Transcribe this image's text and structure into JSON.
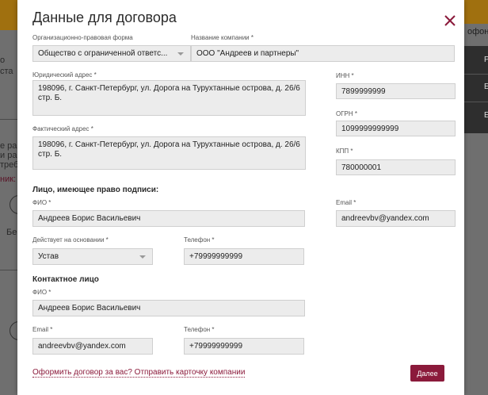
{
  "background": {
    "left_texts": [
      "о",
      "ста",
      "е ра",
      "и ра",
      "треб",
      "ник:",
      "Бе"
    ],
    "right_texts": [
      "офон",
      "Р",
      "Е",
      "Е"
    ]
  },
  "modal": {
    "title": "Данные для договора",
    "close_icon": "close-icon",
    "org_form": {
      "label": "Организационно-правовая форма",
      "value": "Общество с ограниченной ответс..."
    },
    "company_name": {
      "label": "Название компании *",
      "value": "ООО \"Андреев и партнеры\""
    },
    "legal_address": {
      "label": "Юридический адрес *",
      "value": "198096, г. Санкт-Петербург, ул. Дорога на Турухтанные острова, д. 26/6 стр. Б."
    },
    "actual_address": {
      "label": "Фактический адрес *",
      "value": "198096, г. Санкт-Петербург, ул. Дорога на Турухтанные острова, д. 26/6 стр. Б."
    },
    "inn": {
      "label": "ИНН *",
      "value": "7899999999"
    },
    "ogrn": {
      "label": "ОГРН *",
      "value": "1099999999999"
    },
    "kpp": {
      "label": "КПП *",
      "value": "780000001"
    },
    "signatory": {
      "section_title": "Лицо, имеющее право подписи:",
      "fio_label": "ФИО *",
      "fio_value": "Андреев Борис Васильевич",
      "email_label": "Email *",
      "email_value": "andreevbv@yandex.com",
      "basis_label": "Действует на основании *",
      "basis_value": "Устав",
      "phone_label": "Телефон *",
      "phone_value": "+79999999999"
    },
    "contact": {
      "section_title": "Контактное лицо",
      "fio_label": "ФИО *",
      "fio_value": "Андреев Борис Васильевич",
      "email_label": "Email *",
      "email_value": "andreevbv@yandex.com",
      "phone_label": "Телефон *",
      "phone_value": "+79999999999"
    },
    "footer_link": "Оформить договор за вас? Отправить карточку компании",
    "next_button": "Далее"
  },
  "colors": {
    "accent": "#8b1a3b",
    "overlay": "#6f6f6f",
    "field_bg": "#ececec",
    "orange": "#a0700f"
  }
}
